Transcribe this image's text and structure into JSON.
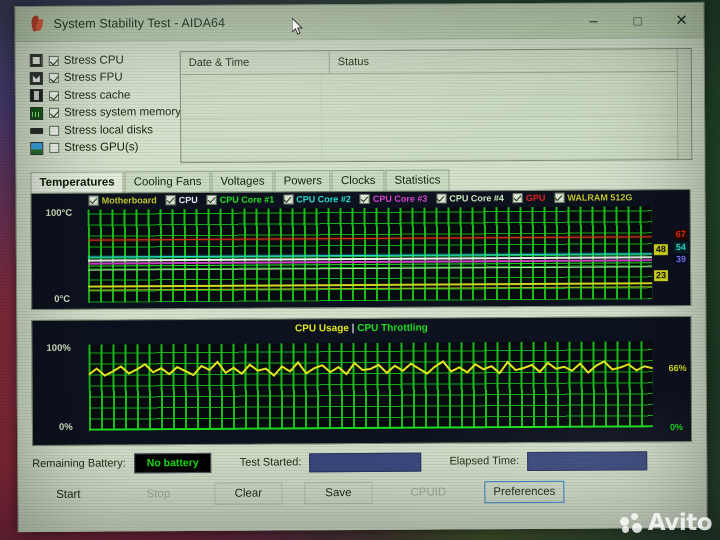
{
  "window": {
    "title": "System Stability Test - AIDA64",
    "icon": "aida64-flame-icon",
    "minimize": "–",
    "maximize": "□",
    "close": "✕"
  },
  "stress_options": [
    {
      "label": "Stress CPU",
      "checked": true,
      "icon": "cpu-chip-icon"
    },
    {
      "label": "Stress FPU",
      "checked": true,
      "icon": "fpu-icon"
    },
    {
      "label": "Stress cache",
      "checked": true,
      "icon": "cache-icon"
    },
    {
      "label": "Stress system memory",
      "checked": true,
      "icon": "memory-module-icon"
    },
    {
      "label": "Stress local disks",
      "checked": false,
      "icon": "hard-disk-icon"
    },
    {
      "label": "Stress GPU(s)",
      "checked": false,
      "icon": "gpu-card-icon"
    }
  ],
  "log_table": {
    "columns": [
      "Date & Time",
      "Status"
    ],
    "rows": []
  },
  "tabs": [
    {
      "label": "Temperatures",
      "active": true
    },
    {
      "label": "Cooling Fans",
      "active": false
    },
    {
      "label": "Voltages",
      "active": false
    },
    {
      "label": "Powers",
      "active": false
    },
    {
      "label": "Clocks",
      "active": false
    },
    {
      "label": "Statistics",
      "active": false
    }
  ],
  "temperature_chart": {
    "axis_top": "100°C",
    "axis_bottom": "0°C",
    "legend": [
      {
        "label": "Motherboard",
        "color": "#c8c832",
        "checked": true
      },
      {
        "label": "CPU",
        "color": "#e6eef0",
        "checked": true
      },
      {
        "label": "CPU Core #1",
        "color": "#22e022",
        "checked": true
      },
      {
        "label": "CPU Core #2",
        "color": "#2ae0d8",
        "checked": true
      },
      {
        "label": "CPU Core #3",
        "color": "#e040d8",
        "checked": true
      },
      {
        "label": "CPU Core #4",
        "color": "#b8e8a8",
        "checked": true
      },
      {
        "label": "GPU",
        "color": "#e02020",
        "checked": true
      },
      {
        "label": "WALRAM 512G",
        "color": "#c8c832",
        "checked": true
      }
    ],
    "values": [
      {
        "value": "67",
        "color": "#ff3020",
        "bg": "#2a0a06"
      },
      {
        "value": "48",
        "color": "#1a1a08",
        "bg": "#d8d820"
      },
      {
        "value": "54",
        "color": "#30f0e8",
        "bg": "#06242a"
      },
      {
        "value": "39",
        "color": "#8080ff",
        "bg": "#0a0a2a"
      },
      {
        "value": "23",
        "color": "#1a1a08",
        "bg": "#d8d820"
      }
    ]
  },
  "usage_chart": {
    "title_usage": "CPU Usage",
    "title_separator": "|",
    "title_throttling": "CPU Throttling",
    "color_usage": "#e8e820",
    "color_throttling": "#22e022",
    "axis_top": "100%",
    "axis_bottom": "0%",
    "values": [
      {
        "value": "66%",
        "color": "#e8e820"
      },
      {
        "value": "0%",
        "color": "#22e022"
      }
    ]
  },
  "status_bar": {
    "battery_label": "Remaining Battery:",
    "battery_value": "No battery",
    "test_started_label": "Test Started:",
    "test_started_value": "",
    "elapsed_label": "Elapsed Time:",
    "elapsed_value": ""
  },
  "buttons": [
    {
      "label": "Start",
      "state": "normal"
    },
    {
      "label": "Stop",
      "state": "disabled"
    },
    {
      "label": "Clear",
      "state": "outline"
    },
    {
      "label": "Save",
      "state": "outline"
    },
    {
      "label": "CPUID",
      "state": "disabled"
    },
    {
      "label": "Preferences",
      "state": "focused"
    }
  ],
  "watermark": {
    "text": "Avito"
  }
}
